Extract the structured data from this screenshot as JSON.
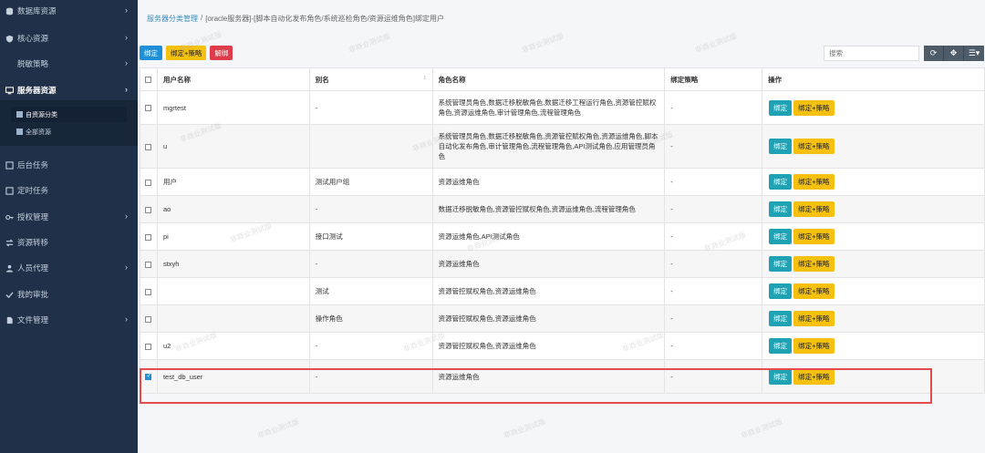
{
  "sidebar": {
    "items": [
      {
        "label": "数据库资源",
        "icon": "database-icon"
      },
      {
        "label": "核心资源",
        "icon": "shield-icon"
      },
      {
        "label": "脱敏策略",
        "icon": "blank"
      },
      {
        "label": "服务器资源",
        "icon": "monitor-icon"
      },
      {
        "label": "后台任务",
        "icon": "task-icon"
      },
      {
        "label": "定时任务",
        "icon": "clock-icon"
      },
      {
        "label": "授权管理",
        "icon": "key-icon"
      },
      {
        "label": "资源转移",
        "icon": "transfer-icon"
      },
      {
        "label": "人员代理",
        "icon": "user-icon"
      },
      {
        "label": "我的审批",
        "icon": "approve-icon"
      },
      {
        "label": "文件管理",
        "icon": "file-icon"
      }
    ],
    "submenu": [
      {
        "label": "自资源分类",
        "icon": "category-icon"
      },
      {
        "label": "全部资源",
        "icon": "all-icon"
      }
    ]
  },
  "breadcrumb": {
    "link": "服务器分类管理",
    "sep": "/",
    "current": "[oracle服务器]-[脚本自动化发布角色/系统巡检角色/资源运维角色]绑定用户"
  },
  "toolbar": {
    "bind": "绑定",
    "bind_policy": "绑定+策略",
    "unbind": "解绑"
  },
  "search": {
    "placeholder": "搜索"
  },
  "table": {
    "headers": [
      "用户名称",
      "别名",
      "角色名称",
      "绑定策略",
      "操作"
    ],
    "op_bind": "绑定",
    "op_bind_policy": "绑定+策略",
    "rows": [
      {
        "username": "mgrtest",
        "alias": "-",
        "roles": "系统管理员角色,数据迁移脱敏角色,数据迁移工程运行角色,资源管控赋权角色,资源运维角色,审计管理角色,流程管理角色",
        "policy": "-",
        "checked": false
      },
      {
        "username": "u",
        "alias": "",
        "roles": "系统管理员角色,数据迁移脱敏角色,资源管控赋权角色,资源运维角色,脚本自动化发布角色,审计管理角色,流程管理角色,API测试角色,应用管理员角色",
        "policy": "-",
        "checked": false
      },
      {
        "username": "用户",
        "alias": "测试用户组",
        "roles": "资源运维角色",
        "policy": "-",
        "checked": false
      },
      {
        "username": "ao",
        "alias": "-",
        "roles": "数据迁移脱敏角色,资源管控赋权角色,资源运维角色,流程管理角色",
        "policy": "-",
        "checked": false
      },
      {
        "username": "pi",
        "alias": "接口测试",
        "roles": "资源运维角色,API测试角色",
        "policy": "-",
        "checked": false
      },
      {
        "username": "stxyh",
        "alias": "-",
        "roles": "资源运维角色",
        "policy": "-",
        "checked": false
      },
      {
        "username": "",
        "alias": "测试",
        "roles": "资源管控赋权角色,资源运维角色",
        "policy": "-",
        "checked": false
      },
      {
        "username": "",
        "alias": "操作角色",
        "roles": "资源管控赋权角色,资源运维角色",
        "policy": "-",
        "checked": false
      },
      {
        "username": "u2",
        "alias": "-",
        "roles": "资源管控赋权角色,资源运维角色",
        "policy": "-",
        "checked": false
      },
      {
        "username": "test_db_user",
        "alias": "-",
        "roles": "资源运维角色",
        "policy": "-",
        "checked": true
      }
    ]
  },
  "watermark": "非商业测试版",
  "colors": {
    "sidebar_bg": "#1f3048",
    "primary": "#1e90d8",
    "warning": "#f6c00f",
    "danger": "#dd3c4a",
    "teal": "#1fa2b3",
    "highlight": "#e54b4b"
  }
}
